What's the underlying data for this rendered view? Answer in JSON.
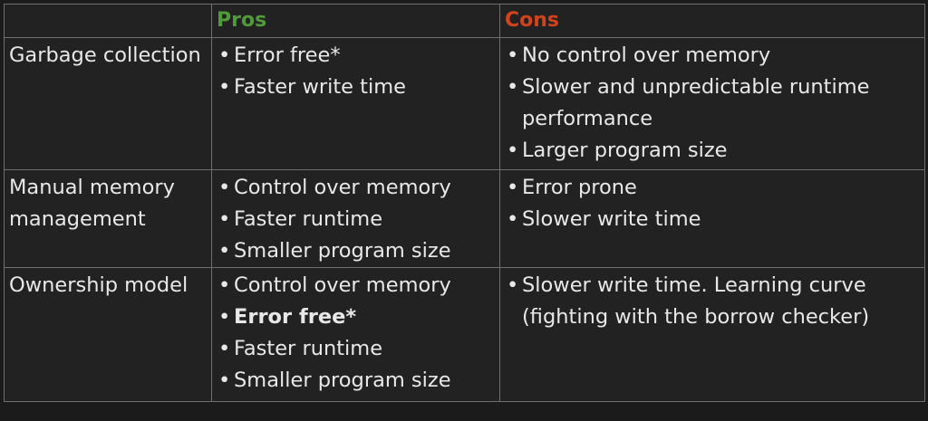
{
  "header": {
    "corner": "",
    "pros": "Pros",
    "cons": "Cons"
  },
  "colors": {
    "pros": "#4f9b3a",
    "cons": "#d0431e",
    "text": "#e8e8e8",
    "border": "#6e6e6e",
    "background": "#222222"
  },
  "bullet_glyph": "•",
  "rows": [
    {
      "label": "Garbage collection",
      "pros": [
        {
          "text": "Error free*",
          "bold": false
        },
        {
          "text": "Faster write time",
          "bold": false
        }
      ],
      "cons": [
        {
          "text": "No control over memory",
          "bold": false
        },
        {
          "text": "Slower and unpredictable runtime performance",
          "bold": false
        },
        {
          "text": "Larger program size",
          "bold": false
        }
      ]
    },
    {
      "label": "Manual memory management",
      "pros": [
        {
          "text": "Control over memory",
          "bold": false
        },
        {
          "text": "Faster runtime",
          "bold": false
        },
        {
          "text": "Smaller program size",
          "bold": false
        }
      ],
      "cons": [
        {
          "text": "Error prone",
          "bold": false
        },
        {
          "text": "Slower write time",
          "bold": false
        }
      ]
    },
    {
      "label": "Ownership model",
      "pros": [
        {
          "text": "Control over memory",
          "bold": false
        },
        {
          "text": "Error free*",
          "bold": true
        },
        {
          "text": "Faster runtime",
          "bold": false
        },
        {
          "text": "Smaller program size",
          "bold": false
        }
      ],
      "cons": [
        {
          "text": "Slower write time. Learning curve (fighting with the borrow checker)",
          "bold": false
        }
      ]
    }
  ]
}
